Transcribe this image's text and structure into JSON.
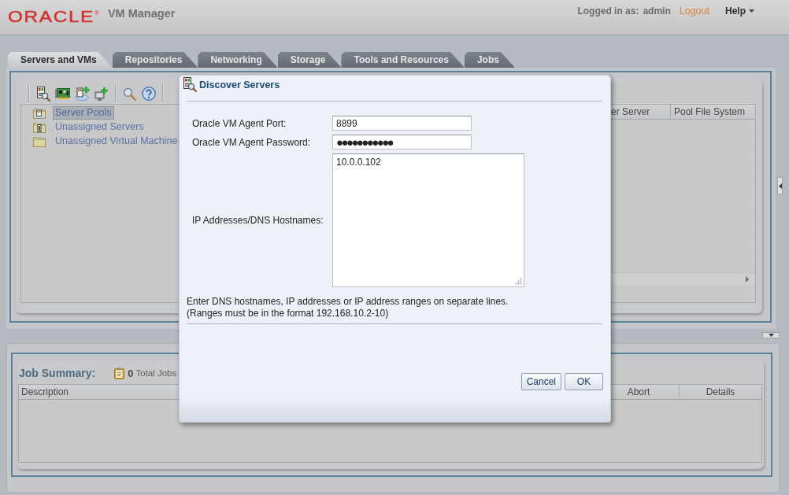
{
  "header": {
    "logo": "ORACLE$^{®}$",
    "product": "VM Manager",
    "logged_in_label": "Logged in as:",
    "user": "admin",
    "logout": "Logout",
    "help": "Help"
  },
  "tabs": [
    {
      "label": "Servers and VMs",
      "selected": true
    },
    {
      "label": "Repositories",
      "selected": false
    },
    {
      "label": "Networking",
      "selected": false
    },
    {
      "label": "Storage",
      "selected": false
    },
    {
      "label": "Tools and Resources",
      "selected": false
    },
    {
      "label": "Jobs",
      "selected": false
    }
  ],
  "tree": [
    {
      "label": "Server Pools",
      "kind": "pools",
      "selected": true
    },
    {
      "label": "Unassigned Servers",
      "kind": "servers",
      "selected": false
    },
    {
      "label": "Unassigned Virtual Machine",
      "kind": "folder",
      "selected": false
    }
  ],
  "table": {
    "columns": [
      "er Server",
      "Pool File System"
    ]
  },
  "job_summary": {
    "title": "Job Summary:",
    "count": "0",
    "count_label": "Total Jobs",
    "columns": [
      "Description",
      "Abort",
      "Details"
    ]
  },
  "dialog": {
    "title": "Discover Servers",
    "fields": [
      {
        "label": "Oracle VM Agent Port:",
        "value": "8899",
        "kind": "text"
      },
      {
        "label": "Oracle VM Agent Password:",
        "value": "●●●●●●●●●●●",
        "kind": "password"
      },
      {
        "label": "IP Addresses/DNS Hostnames:",
        "value": "10.0.0.102",
        "kind": "textarea"
      }
    ],
    "help": [
      "Enter DNS hostnames, IP addresses or IP address ranges on separate lines.",
      "(Ranges must be in the format 192.168.10.2-10)"
    ],
    "buttons": [
      "Cancel",
      "OK"
    ]
  }
}
